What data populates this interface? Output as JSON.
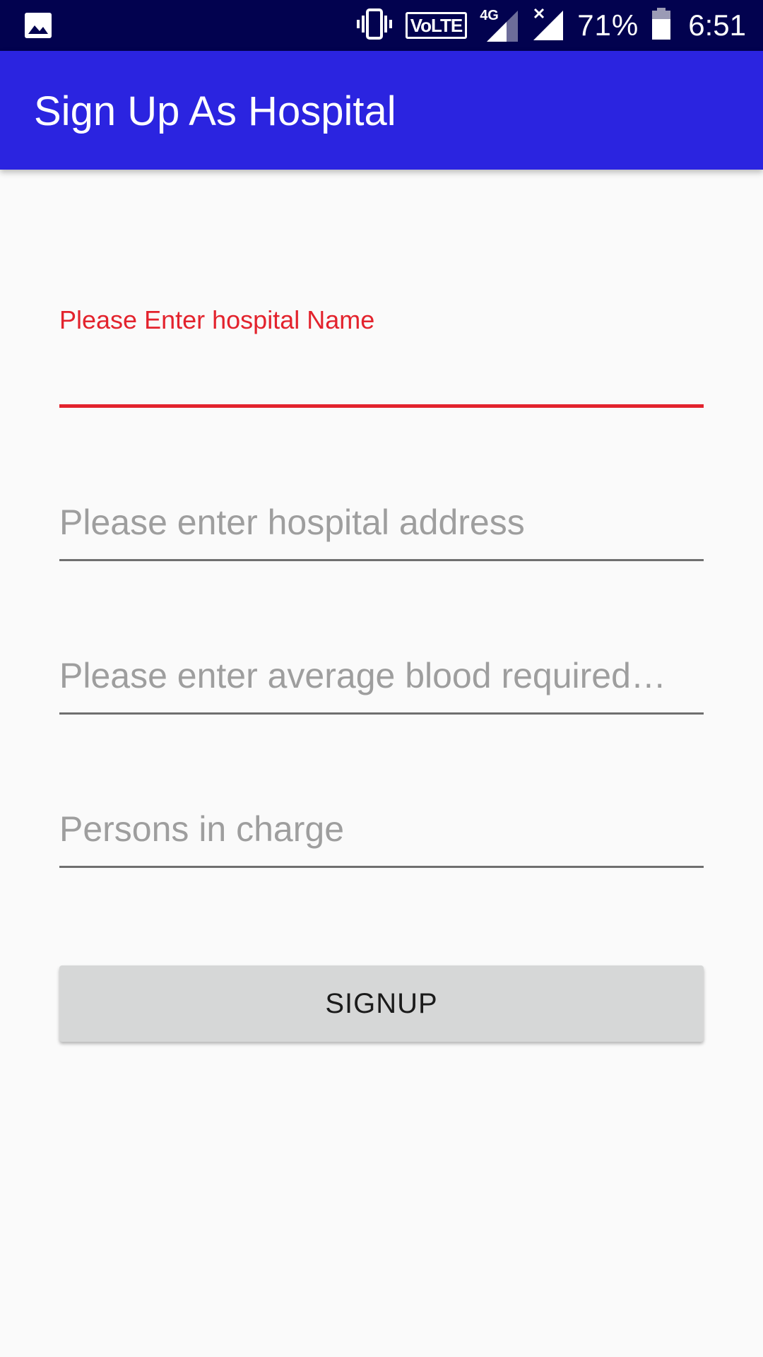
{
  "status_bar": {
    "gallery_icon": "image-icon",
    "vibrate_icon": "vibrate-icon",
    "volte_label": "VoLTE",
    "network_label": "4G",
    "battery_percent": "71%",
    "time": "6:51",
    "background_color": "#02024f"
  },
  "app_bar": {
    "title": "Sign Up As Hospital",
    "background_color": "#2b24e0"
  },
  "form": {
    "hospital_name": {
      "label": "Please Enter hospital Name",
      "value": "",
      "error_color": "#e3232d"
    },
    "hospital_address": {
      "placeholder": "Please enter hospital address",
      "value": ""
    },
    "average_blood": {
      "placeholder": "Please enter average blood required…",
      "value": ""
    },
    "persons_in_charge": {
      "placeholder": "Persons in charge",
      "value": ""
    },
    "signup_label": "SIGNUP"
  }
}
